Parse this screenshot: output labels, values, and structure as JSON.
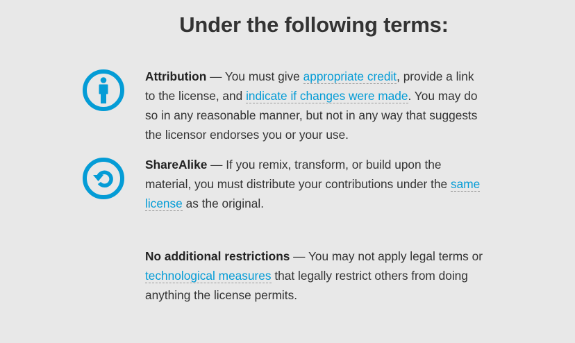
{
  "heading": "Under the following terms:",
  "terms": [
    {
      "icon": "attribution-icon",
      "title": "Attribution",
      "p1": " — You must give ",
      "link1": "appropriate credit",
      "p2": ", provide a link to the license, and ",
      "link2": "indicate if changes were made",
      "p3": ". You may do so in any reasonable manner, but not in any way that suggests the licensor endorses you or your use."
    },
    {
      "icon": "sharealike-icon",
      "title": "ShareAlike",
      "p1": " — If you remix, transform, or build upon the material, you must distribute your contributions under the ",
      "link1": "same license",
      "p2": " as the original."
    },
    {
      "title": "No additional restrictions",
      "p1": " — You may not apply legal terms or ",
      "link1": "technological measures",
      "p2": " that legally restrict others from doing anything the license permits."
    }
  ],
  "colors": {
    "accent": "#049cd6",
    "background": "#e8e8e8",
    "text": "#333333"
  }
}
